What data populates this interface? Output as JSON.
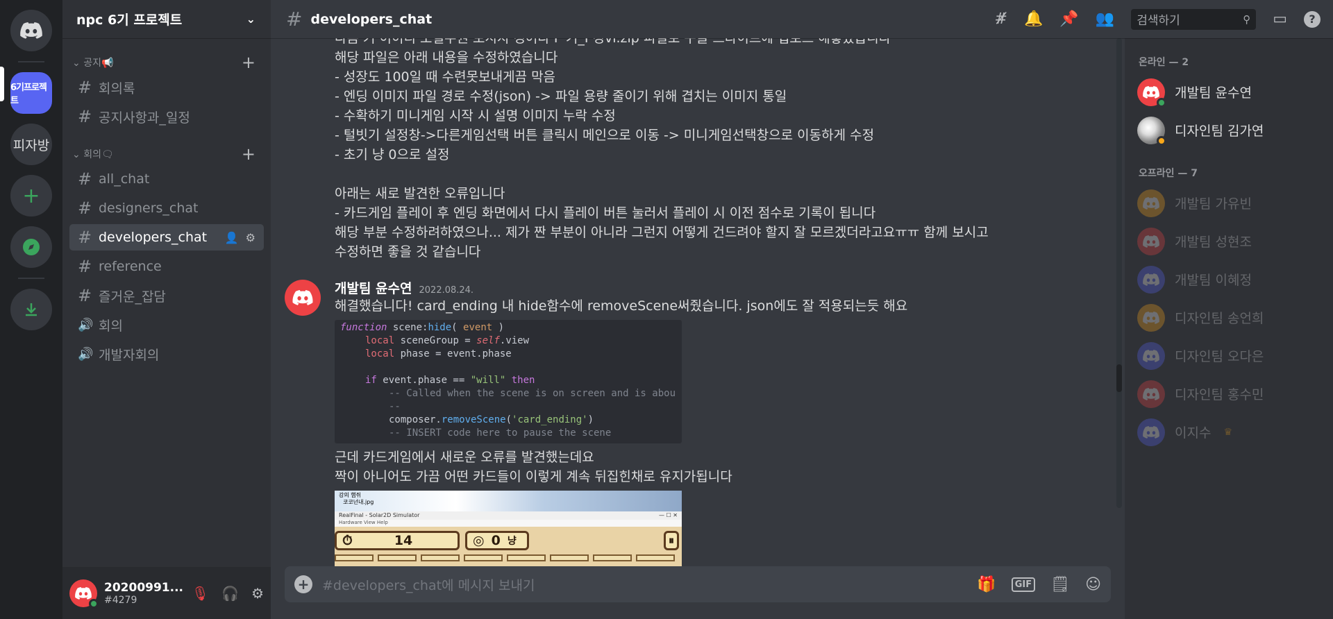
{
  "rail": {
    "active_server_label": "6기프로젝트",
    "server2_label": "피자방"
  },
  "guild": {
    "name": "npc 6기 프로젝트"
  },
  "categories": [
    {
      "label": "공지📢",
      "channels": [
        {
          "name": "회의록",
          "type": "text"
        },
        {
          "name": "공지사항과_일정",
          "type": "text"
        }
      ]
    },
    {
      "label": "회의🗨",
      "channels": [
        {
          "name": "all_chat",
          "type": "text"
        },
        {
          "name": "designers_chat",
          "type": "text"
        },
        {
          "name": "developers_chat",
          "type": "text",
          "active": true
        },
        {
          "name": "reference",
          "type": "text"
        },
        {
          "name": "즐거운_잡담",
          "type": "text"
        },
        {
          "name": "회의",
          "type": "voice"
        },
        {
          "name": "개발자회의",
          "type": "voice"
        }
      ]
    }
  ],
  "user": {
    "name": "20200991...",
    "tag": "#4279"
  },
  "channel": {
    "title": "developers_chat",
    "search_placeholder": "검색하기"
  },
  "messages": {
    "cut_line": "다음 커 이이디 도설주권 보시지 경어다 F 기_I 경vi.zip 피일로 구글 드라이브에 업로드 해놓았습니다",
    "prev_lines": [
      "해당 파일은 아래 내용을 수정하였습니다",
      "- 성장도 100일 때 수련못보내게끔 막음",
      "- 엔딩 이미지 파일 경로 수정(json) -> 파일 용량 줄이기 위해 겹치는 이미지 통일",
      "- 수확하기 미니게임 시작 시 설명 이미지 누락 수정",
      "- 털빗기 설정창->다른게임선택 버튼 클릭시 메인으로 이동 -> 미니게임선택창으로 이동하게 수정",
      "- 초기 냥 0으로 설정",
      "",
      "아래는 새로 발견한 오류입니다",
      "- 카드게임 플레이 후 엔딩 화면에서  다시 플레이 버튼 눌러서 플레이 시 이전 점수로 기록이 됩니다",
      "해당 부분 수정하려하였으나... 제가 짠 부분이 아니라 그런지 어떻게 건드려야 할지 잘 모르겠더라고요ㅠㅠ 함께 보시고",
      "수정하면 좋을 것 같습니다"
    ],
    "msg2": {
      "author": "개발팀 윤수연",
      "date": "2022.08.24.",
      "text1": "해결했습니다! card_ending 내 hide함수에 removeScene써줬습니다. json에도 잘 적용되는듯 해요",
      "text2": "근데 카드게임에서 새로운 오류를 발견했는데요",
      "text3": "짝이 아니어도 가끔 어떤 카드들이 이렇게 계속 뒤집힌채로 유지가됩니다"
    },
    "code": {
      "l1_kw": "function",
      "l1_fn": "scene:",
      "l1_fn2": "hide",
      "l1_rest": "( ",
      "l1_arg": "event",
      "l1_end": " )",
      "l2_kw": "local",
      "l2_a": " sceneGroup = ",
      "l2_self": "self",
      "l2_b": ".view",
      "l3_kw": "local",
      "l3_a": " phase = event.phase",
      "l5_kw": "if",
      "l5_a": " event.phase == ",
      "l5_str": "\"will\"",
      "l5_then": " then",
      "l6": "-- Called when the scene is on screen and is abou",
      "l7": "--",
      "l8_a": "composer.",
      "l8_fn": "removeScene",
      "l8_str": "'card_ending'",
      "l9": "-- INSERT code here to pause the scene"
    },
    "game": {
      "top1": "강의           햄쥐",
      "top2": "코코넌내.jpg",
      "window_title": "RealFinal - Solar2D Simulator",
      "window_btns": "—   ☐   ✕",
      "menu": "Hardware   View   Help",
      "timer_icon": "⏱",
      "timer_value": "14",
      "coin_icon": "◎",
      "coin_value": "0",
      "coin_unit": "냥",
      "pause_icon": "⏸"
    }
  },
  "composer": {
    "placeholder": "#developers_chat에 메시지 보내기"
  },
  "members": {
    "online_header": "온라인 — 2",
    "offline_header": "오프라인 — 7",
    "online": [
      {
        "name": "개발팀 윤수연",
        "color": "#ed4245",
        "status": "online"
      },
      {
        "name": "디자인팀 김가연",
        "color": "photo",
        "status": "idle"
      }
    ],
    "offline": [
      {
        "name": "개발팀 가유빈",
        "color": "#faa61a"
      },
      {
        "name": "개발팀 성현조",
        "color": "#ed4245"
      },
      {
        "name": "개발팀 이혜정",
        "color": "#5865f2"
      },
      {
        "name": "디자인팀 송언희",
        "color": "#faa61a"
      },
      {
        "name": "디자인팀 오다은",
        "color": "#5865f2"
      },
      {
        "name": "디자인팀 홍수민",
        "color": "#ed4245"
      },
      {
        "name": "이지수",
        "color": "#5865f2",
        "crown": true
      }
    ]
  }
}
